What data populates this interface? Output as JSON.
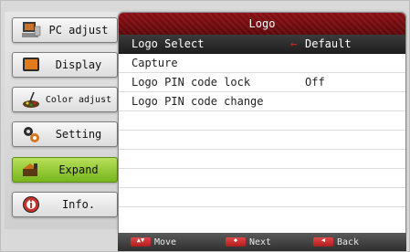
{
  "sidebar": {
    "items": [
      {
        "label": "PC adjust",
        "icon": "pc-adjust-icon"
      },
      {
        "label": "Display",
        "icon": "display-icon"
      },
      {
        "label": "Color adjust",
        "icon": "color-adjust-icon"
      },
      {
        "label": "Setting",
        "icon": "setting-icon"
      },
      {
        "label": "Expand",
        "icon": "expand-icon",
        "active": true
      },
      {
        "label": "Info.",
        "icon": "info-icon"
      }
    ]
  },
  "panel": {
    "title": "Logo",
    "rows": [
      {
        "label": "Logo Select",
        "value": "Default",
        "selected": true
      },
      {
        "label": "Capture",
        "value": ""
      },
      {
        "label": "Logo PIN code lock",
        "value": "Off"
      },
      {
        "label": "Logo PIN code change",
        "value": ""
      }
    ]
  },
  "footer": {
    "move_label": "Move",
    "next_label": "Next",
    "back_label": "Back"
  },
  "colors": {
    "title_bar": "#7a0c10",
    "active_item": "#8cc63f",
    "selected_row": "#2a2a2a",
    "arrow": "#e0201e"
  }
}
